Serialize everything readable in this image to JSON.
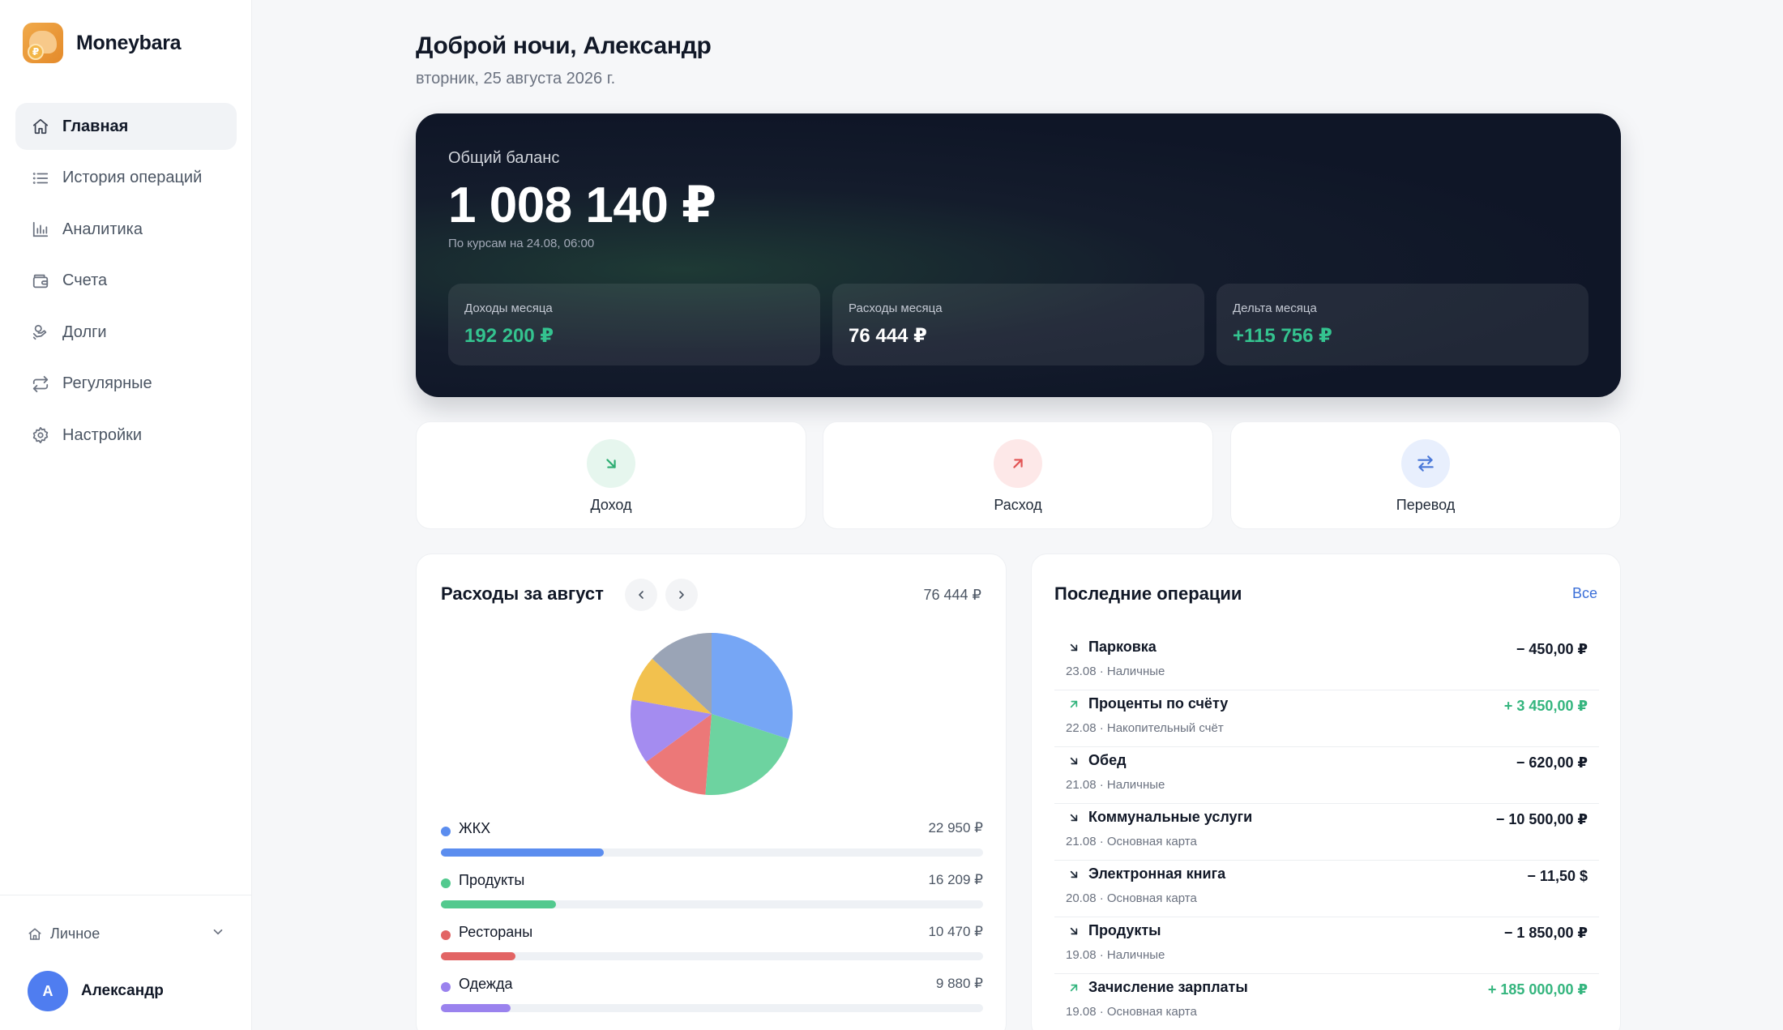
{
  "brand": {
    "name": "Moneybara",
    "logo_coin": "₽"
  },
  "sidebar": {
    "items": [
      {
        "label": "Главная",
        "icon": "home-icon",
        "active": true
      },
      {
        "label": "История операций",
        "icon": "list-icon",
        "active": false
      },
      {
        "label": "Аналитика",
        "icon": "bar-chart-icon",
        "active": false
      },
      {
        "label": "Счета",
        "icon": "wallet-icon",
        "active": false
      },
      {
        "label": "Долги",
        "icon": "handshake-icon",
        "active": false
      },
      {
        "label": "Регулярные",
        "icon": "repeat-icon",
        "active": false
      },
      {
        "label": "Настройки",
        "icon": "gear-icon",
        "active": false
      }
    ],
    "profile_switch": "Личное",
    "user": {
      "initial": "А",
      "name": "Александр"
    }
  },
  "header": {
    "greeting": "Доброй ночи, Александр",
    "date": "вторник, 25 августа 2026 г."
  },
  "balance": {
    "label": "Общий баланс",
    "value": "1 008 140 ₽",
    "note": "По курсам на 24.08, 06:00",
    "stats": [
      {
        "label": "Доходы месяца",
        "value": "192 200 ₽",
        "color": "#34c38f"
      },
      {
        "label": "Расходы месяца",
        "value": "76 444 ₽",
        "color": "#ffffff"
      },
      {
        "label": "Дельта месяца",
        "value": "+115 756 ₽",
        "color": "#34c38f"
      }
    ]
  },
  "actions": [
    {
      "label": "Доход",
      "icon": "arrow-down-right-icon",
      "bg": "#e6f6ee",
      "color": "#2fae73"
    },
    {
      "label": "Расход",
      "icon": "arrow-up-right-icon",
      "bg": "#fde8e8",
      "color": "#e25555"
    },
    {
      "label": "Перевод",
      "icon": "transfer-icon",
      "bg": "#e8effd",
      "color": "#4a78d8"
    }
  ],
  "expenses": {
    "title": "Расходы за август",
    "total": "76 444 ₽",
    "chart_data": {
      "type": "pie",
      "slices": [
        {
          "name": "ЖКХ",
          "value": 22950,
          "color": "#76a6f5"
        },
        {
          "name": "Продукты",
          "value": 16209,
          "color": "#6dd3a0"
        },
        {
          "name": "Рестораны",
          "value": 10470,
          "color": "#ec7878"
        },
        {
          "name": "Одежда",
          "value": 9880,
          "color": "#a48cf0"
        },
        {
          "name": "",
          "value": 6944,
          "color": "#f2c14e"
        },
        {
          "name": "",
          "value": 9991,
          "color": "#9aa4b6"
        }
      ]
    },
    "categories": [
      {
        "name": "ЖКХ",
        "amount": "22 950 ₽",
        "share": 0.3,
        "color": "#5b8def"
      },
      {
        "name": "Продукты",
        "amount": "16 209 ₽",
        "share": 0.212,
        "color": "#52c98e"
      },
      {
        "name": "Рестораны",
        "amount": "10 470 ₽",
        "share": 0.137,
        "color": "#e26464"
      },
      {
        "name": "Одежда",
        "amount": "9 880 ₽",
        "share": 0.129,
        "color": "#9a82ee"
      }
    ]
  },
  "operations": {
    "title": "Последние операции",
    "all_label": "Все",
    "items": [
      {
        "name": "Парковка",
        "meta": "23.08 · Наличные",
        "amount": "− 450,00 ₽",
        "type": "expense"
      },
      {
        "name": "Проценты по счёту",
        "meta": "22.08 · Накопительный счёт",
        "amount": "+ 3 450,00 ₽",
        "type": "income"
      },
      {
        "name": "Обед",
        "meta": "21.08 · Наличные",
        "amount": "− 620,00 ₽",
        "type": "expense"
      },
      {
        "name": "Коммунальные услуги",
        "meta": "21.08 · Основная карта",
        "amount": "− 10 500,00 ₽",
        "type": "expense"
      },
      {
        "name": "Электронная книга",
        "meta": "20.08 · Основная карта",
        "amount": "− 11,50 $",
        "type": "expense"
      },
      {
        "name": "Продукты",
        "meta": "19.08 · Наличные",
        "amount": "− 1 850,00 ₽",
        "type": "expense"
      },
      {
        "name": "Зачисление зарплаты",
        "meta": "19.08 · Основная карта",
        "amount": "+ 185 000,00 ₽",
        "type": "income"
      }
    ]
  }
}
